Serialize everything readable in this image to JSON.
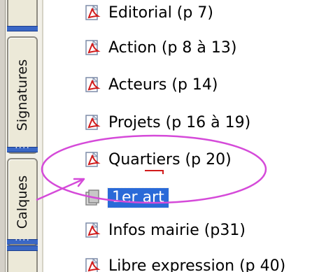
{
  "left_panel": {
    "tabs": [
      {
        "label": "Signatures"
      },
      {
        "label": "Calques"
      }
    ]
  },
  "bookmarks": [
    {
      "label": "Editorial (p 7)",
      "icon": "pdf-bookmark-icon"
    },
    {
      "label": "Action (p 8 à 13)",
      "icon": "pdf-bookmark-icon"
    },
    {
      "label": "Acteurs (p 14)",
      "icon": "pdf-bookmark-icon"
    },
    {
      "label": "Projets (p 16 à 19)",
      "icon": "pdf-bookmark-icon"
    },
    {
      "label": "Quartiers (p 20)",
      "icon": "pdf-bookmark-icon"
    },
    {
      "label": "1er art",
      "icon": "bookmark-page-icon",
      "selected": true
    },
    {
      "label": "Infos mairie (p31)",
      "icon": "pdf-bookmark-icon"
    },
    {
      "label": "Libre expression (p 40)",
      "icon": "pdf-bookmark-icon"
    }
  ],
  "colors": {
    "selection": "#2a6ad8",
    "annotation": "#d54ad9",
    "pdf_red": "#d11b1b"
  }
}
